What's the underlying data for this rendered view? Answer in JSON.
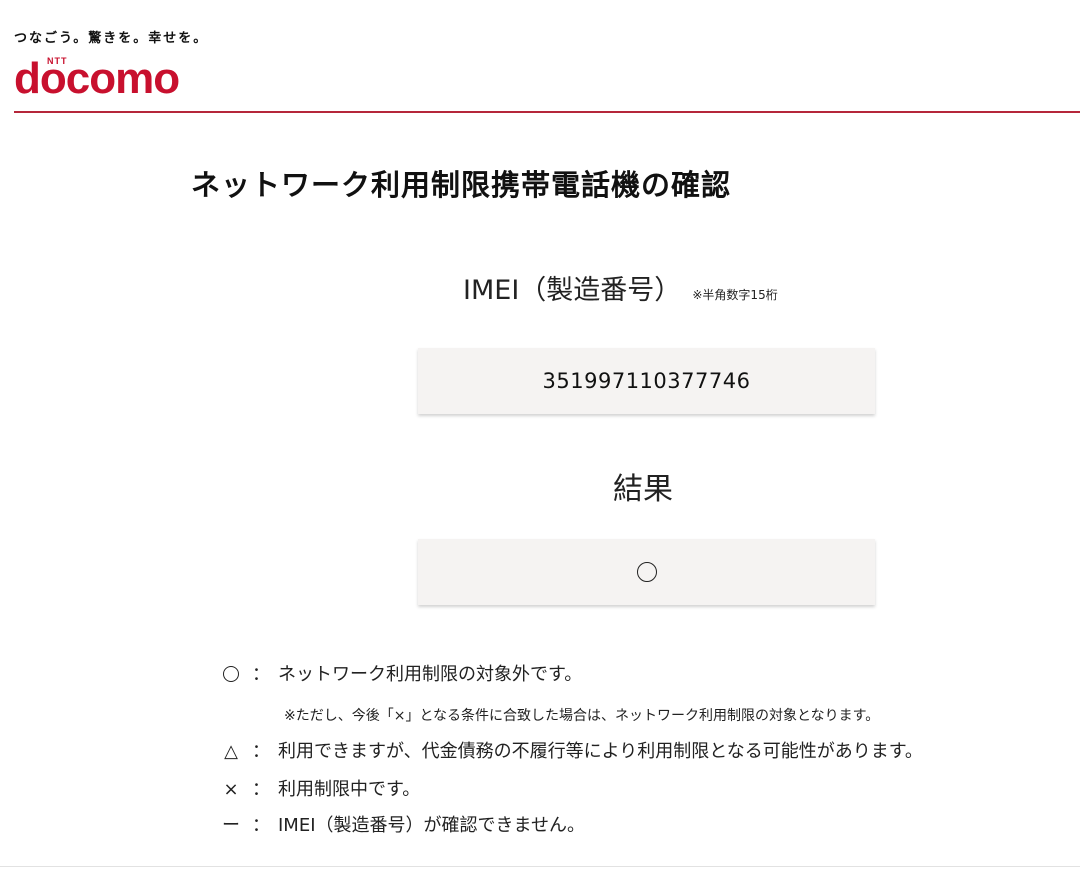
{
  "header": {
    "tagline": "つなごう。驚きを。幸せを。",
    "logo_small": "NTT",
    "logo_word": "docomo",
    "brand_color": "#c8102e"
  },
  "page": {
    "title": "ネットワーク利用制限携帯電話機の確認"
  },
  "imei": {
    "label": "IMEI（製造番号）",
    "note": "※半角数字15桁",
    "value": "351997110377746"
  },
  "result": {
    "label": "結果",
    "value_icon": "circle-icon"
  },
  "legend": {
    "items": [
      {
        "symbol_icon": "circle-icon",
        "colon": "：",
        "text": "ネットワーク利用制限の対象外です。"
      },
      {
        "symbol": "△",
        "colon": "：",
        "text": "利用できますが、代金債務の不履行等により利用制限となる可能性があります。"
      },
      {
        "symbol": "×",
        "colon": "：",
        "text": "利用制限中です。"
      },
      {
        "symbol": "ー",
        "colon": "：",
        "text": "IMEI（製造番号）が確認できません。"
      }
    ],
    "note": "※ただし、今後「×」となる条件に合致した場合は、ネットワーク利用制限の対象となります。"
  }
}
